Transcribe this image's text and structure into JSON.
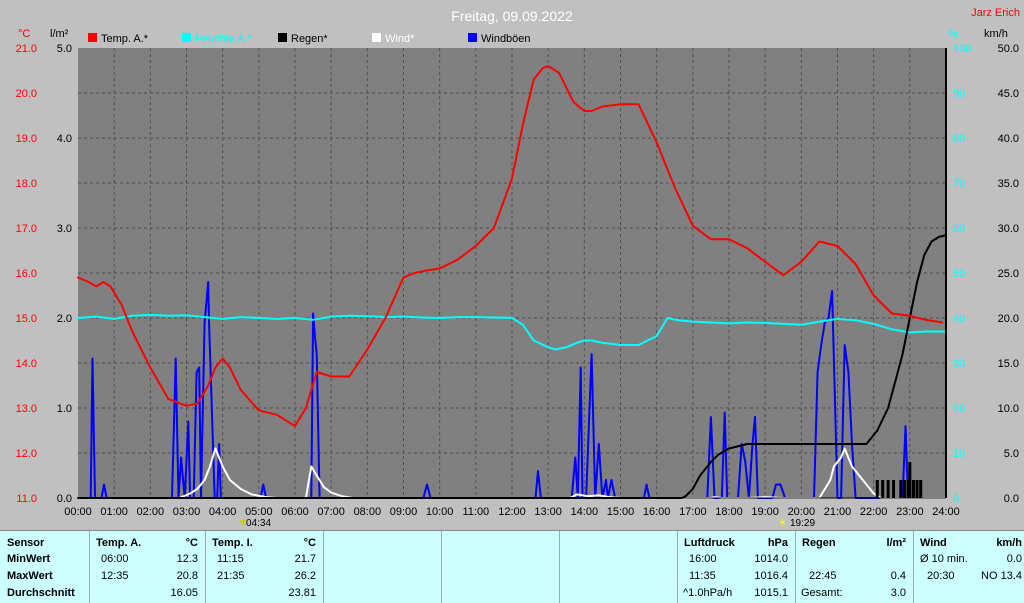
{
  "chart_data": {
    "type": "line",
    "title": "Freitag, 09.09.2022",
    "credit": "Jarz Erich",
    "axes": {
      "temp_unit": "°C",
      "rain_unit": "l/m²",
      "hum_unit": "%",
      "wind_unit": "km/h",
      "temp_range": [
        11,
        21
      ],
      "rain_range": [
        0,
        5
      ],
      "hum_range": [
        0,
        100
      ],
      "wind_range": [
        0,
        50
      ],
      "temp_ticks": [
        "11.0",
        "12.0",
        "13.0",
        "14.0",
        "15.0",
        "16.0",
        "17.0",
        "18.0",
        "19.0",
        "20.0",
        "21.0"
      ],
      "rain_ticks": [
        "0.0",
        "1.0",
        "2.0",
        "3.0",
        "4.0",
        "5.0"
      ],
      "hum_ticks": [
        "0",
        "10",
        "20",
        "30",
        "40",
        "50",
        "60",
        "70",
        "80",
        "90",
        "100"
      ],
      "wind_ticks": [
        "0.0",
        "5.0",
        "10.0",
        "15.0",
        "20.0",
        "25.0",
        "30.0",
        "35.0",
        "40.0",
        "45.0",
        "50.0"
      ],
      "x_ticks": [
        "00:00",
        "01:00",
        "02:00",
        "03:00",
        "04:00",
        "05:00",
        "06:00",
        "07:00",
        "08:00",
        "09:00",
        "10:00",
        "11:00",
        "12:00",
        "13:00",
        "14:00",
        "15:00",
        "16:00",
        "17:00",
        "18:00",
        "19:00",
        "20:00",
        "21:00",
        "22:00",
        "23:00",
        "24:00"
      ]
    },
    "sunrise": "04:34",
    "sunset": "19:29",
    "legend": [
      {
        "label": "Temp. A.*",
        "color": "#ff0000"
      },
      {
        "label": "Feuchte A.*",
        "color": "#00ffff"
      },
      {
        "label": "Regen*",
        "color": "#000000"
      },
      {
        "label": "Wind*",
        "color": "#ffffff"
      },
      {
        "label": "Windböen",
        "color": "#0000ff"
      }
    ],
    "series": [
      {
        "name": "Temp. A.*",
        "axis": "temp",
        "color": "#ff0000",
        "x": [
          0,
          0.3,
          0.5,
          0.7,
          0.9,
          1.2,
          1.5,
          2,
          2.5,
          3,
          3.3,
          3.6,
          3.8,
          4,
          4.2,
          4.5,
          5,
          5.5,
          6,
          6.3,
          6.6,
          7,
          7.5,
          8,
          8.5,
          9,
          9.3,
          9.6,
          10,
          10.5,
          11,
          11.5,
          12,
          12.3,
          12.6,
          12.85,
          13,
          13.3,
          13.7,
          14,
          14.2,
          14.5,
          15,
          15.5,
          16,
          16.5,
          17,
          17.5,
          18,
          18.5,
          19,
          19.5,
          20,
          20.5,
          21,
          21.5,
          22,
          22.5,
          23,
          23.5,
          23.9
        ],
        "y": [
          15.9,
          15.8,
          15.7,
          15.8,
          15.7,
          15.3,
          14.7,
          13.9,
          13.2,
          13.05,
          13.1,
          13.5,
          13.9,
          14.1,
          13.9,
          13.4,
          12.95,
          12.85,
          12.6,
          13.0,
          13.8,
          13.7,
          13.7,
          14.3,
          15.0,
          15.9,
          16.0,
          16.05,
          16.1,
          16.3,
          16.6,
          17.0,
          18.1,
          19.3,
          20.3,
          20.55,
          20.6,
          20.45,
          19.8,
          19.6,
          19.6,
          19.7,
          19.75,
          19.75,
          18.9,
          17.9,
          17.05,
          16.75,
          16.75,
          16.55,
          16.25,
          15.95,
          16.25,
          16.7,
          16.6,
          16.2,
          15.5,
          15.1,
          15.05,
          14.95,
          14.9
        ]
      },
      {
        "name": "Feuchte A.*",
        "axis": "hum",
        "color": "#00ffff",
        "x": [
          0,
          0.5,
          1,
          1.5,
          2,
          2.5,
          3,
          3.5,
          4,
          4.5,
          5,
          5.5,
          6,
          6.5,
          7,
          7.5,
          8,
          8.5,
          9,
          9.5,
          10,
          10.5,
          11,
          11.5,
          12,
          12.3,
          12.6,
          13,
          13.2,
          13.5,
          13.8,
          14,
          14.2,
          14.5,
          15,
          15.5,
          16,
          16.3,
          16.6,
          17,
          17.5,
          18,
          18.5,
          19,
          19.5,
          20,
          20.5,
          21,
          21.5,
          22,
          22.5,
          23,
          23.5,
          24
        ],
        "y": [
          40,
          40.3,
          39.8,
          40.5,
          40.7,
          40.5,
          40.6,
          40.2,
          39.8,
          40.2,
          40,
          39.8,
          40,
          39.6,
          40.3,
          40.5,
          40.4,
          40.2,
          40.3,
          40.1,
          40,
          40.2,
          40.2,
          40.1,
          40,
          38.5,
          35,
          33.5,
          33,
          33.5,
          34.5,
          35,
          35,
          34.5,
          34,
          34,
          36,
          40,
          39.5,
          39.2,
          39,
          38.8,
          39,
          38.9,
          38.7,
          38.5,
          39.2,
          39.8,
          39.5,
          38.7,
          37.5,
          36.8,
          37,
          37
        ]
      },
      {
        "name": "Regen*",
        "axis": "rain",
        "color": "#000000",
        "x": [
          0,
          16.7,
          16.8,
          17,
          17.2,
          17.5,
          17.7,
          18,
          18.5,
          19,
          19.5,
          20,
          20.5,
          21,
          21.5,
          21.8,
          22.1,
          22.4,
          22.6,
          22.8,
          23,
          23.2,
          23.4,
          23.6,
          23.8,
          24
        ],
        "y": [
          0,
          0,
          0.02,
          0.1,
          0.25,
          0.4,
          0.48,
          0.55,
          0.6,
          0.6,
          0.6,
          0.6,
          0.6,
          0.6,
          0.6,
          0.6,
          0.75,
          1.0,
          1.3,
          1.6,
          2.0,
          2.4,
          2.7,
          2.85,
          2.9,
          2.92
        ]
      },
      {
        "name": "Wind*",
        "axis": "wind",
        "color": "#ffffff",
        "x": [
          0,
          2.8,
          3.1,
          3.3,
          3.5,
          3.65,
          3.8,
          4,
          4.2,
          4.5,
          4.8,
          5.2,
          5.5,
          6.3,
          6.45,
          6.6,
          6.8,
          7,
          7.3,
          7.6,
          7.8,
          9,
          13.6,
          13.8,
          14.1,
          14.4,
          14.7,
          15,
          17.5,
          17.6,
          17.8,
          18.5,
          19,
          19.5,
          20.5,
          20.8,
          20.9,
          21,
          21.1,
          21.2,
          21.4,
          21.6,
          21.8,
          22,
          22.2,
          24
        ],
        "y": [
          0,
          0,
          0.5,
          1,
          2,
          3.5,
          5.5,
          3.5,
          2,
          1,
          0.4,
          0.1,
          0,
          0,
          3.5,
          2.5,
          1.2,
          0.6,
          0.2,
          0,
          0,
          0,
          0,
          0.4,
          0.2,
          0.3,
          0.1,
          0,
          0,
          0.1,
          0,
          0,
          0.1,
          0,
          0,
          2,
          3.5,
          4,
          4.5,
          5.5,
          3.5,
          2.5,
          1.5,
          0.5,
          0,
          0
        ]
      },
      {
        "name": "Windböen",
        "axis": "wind",
        "color": "#0000ff",
        "type": "spikes",
        "x": [
          0.35,
          0.4,
          0.47,
          0.65,
          0.72,
          0.79,
          2.6,
          2.7,
          2.78,
          2.85,
          2.95,
          3.05,
          3.1,
          3.2,
          3.28,
          3.35,
          3.4,
          3.5,
          3.6,
          3.62,
          3.7,
          3.78,
          3.85,
          3.9,
          3.95,
          5.05,
          5.12,
          5.2,
          6.45,
          6.5,
          6.55,
          6.6,
          6.68,
          6.78,
          9.55,
          9.65,
          9.75,
          12.65,
          12.72,
          12.8,
          13.65,
          13.75,
          13.82,
          13.9,
          13.95,
          14.05,
          14.2,
          14.3,
          14.4,
          14.5,
          14.6,
          14.65,
          14.75,
          14.85,
          15.65,
          15.72,
          15.8,
          17.4,
          17.5,
          17.6,
          17.8,
          17.88,
          17.95,
          18.25,
          18.35,
          18.45,
          18.55,
          18.65,
          18.72,
          18.8,
          19.2,
          19.3,
          19.42,
          19.55,
          20.35,
          20.45,
          20.55,
          20.65,
          20.75,
          20.85,
          21.0,
          21.1,
          21.2,
          21.3,
          21.4,
          21.5,
          21.65,
          21.75,
          22.8,
          22.88,
          22.95
        ],
        "y": [
          0,
          15.5,
          0,
          0,
          1.5,
          0,
          0,
          15.5,
          0,
          4.5,
          0,
          8.5,
          0,
          0,
          14,
          14.5,
          0,
          19.5,
          24,
          20,
          10,
          0,
          0,
          6,
          0,
          0,
          1.5,
          0,
          0,
          20.5,
          18,
          16,
          0,
          0,
          0,
          1.5,
          0,
          0,
          3,
          0,
          0,
          4.5,
          0,
          14.5,
          0,
          0,
          16,
          0,
          6,
          0,
          2,
          0,
          2,
          0,
          0,
          1.5,
          0,
          0,
          9,
          0,
          0,
          9.5,
          0,
          0,
          6,
          4,
          0,
          6,
          9,
          0,
          0,
          1.5,
          1.5,
          0,
          0,
          14,
          17,
          19.5,
          20,
          23,
          0,
          0,
          17,
          14,
          6,
          0,
          0,
          0,
          0,
          8,
          0
        ]
      }
    ],
    "rain_bars": [
      {
        "x": 22.1,
        "v": 0.2
      },
      {
        "x": 22.25,
        "v": 0.2
      },
      {
        "x": 22.4,
        "v": 0.2
      },
      {
        "x": 22.55,
        "v": 0.2
      },
      {
        "x": 22.75,
        "v": 0.2
      },
      {
        "x": 22.85,
        "v": 0.2
      },
      {
        "x": 22.95,
        "v": 0.2
      },
      {
        "x": 23.0,
        "v": 0.4
      },
      {
        "x": 23.1,
        "v": 0.2
      },
      {
        "x": 23.2,
        "v": 0.2
      },
      {
        "x": 23.3,
        "v": 0.2
      }
    ]
  },
  "panel": {
    "sensor": {
      "head": "Sensor",
      "rows": [
        "MinWert",
        "MaxWert",
        "Durchschnitt"
      ]
    },
    "temp_a": {
      "head": "Temp. A.",
      "unit": "°C",
      "min_time": "06:00",
      "min_val": "12.3",
      "max_time": "12:35",
      "max_val": "20.8",
      "avg": "16.05"
    },
    "temp_i": {
      "head": "Temp. I.",
      "unit": "°C",
      "min_time": "11:15",
      "min_val": "21.7",
      "max_time": "21:35",
      "max_val": "26.2",
      "avg": "23.81"
    },
    "pressure": {
      "head": "Luftdruck",
      "unit": "hPa",
      "r1_time": "16:00",
      "r1_val": "1014.0",
      "r2_time": "11:35",
      "r2_val": "1016.4",
      "r3_label": "^1.0hPa/h",
      "r3_val": "1015.1"
    },
    "rain": {
      "head": "Regen",
      "unit": "l/m²",
      "r2_time": "22:45",
      "r2_val": "0.4",
      "r3_label": "Gesamt:",
      "r3_val": "3.0"
    },
    "wind": {
      "head": "Wind",
      "unit": "km/h",
      "r1_label": "Ø 10 min.",
      "r1_val": "0.0",
      "r2_time": "20:30",
      "r2_val": "NO 13.4"
    }
  }
}
